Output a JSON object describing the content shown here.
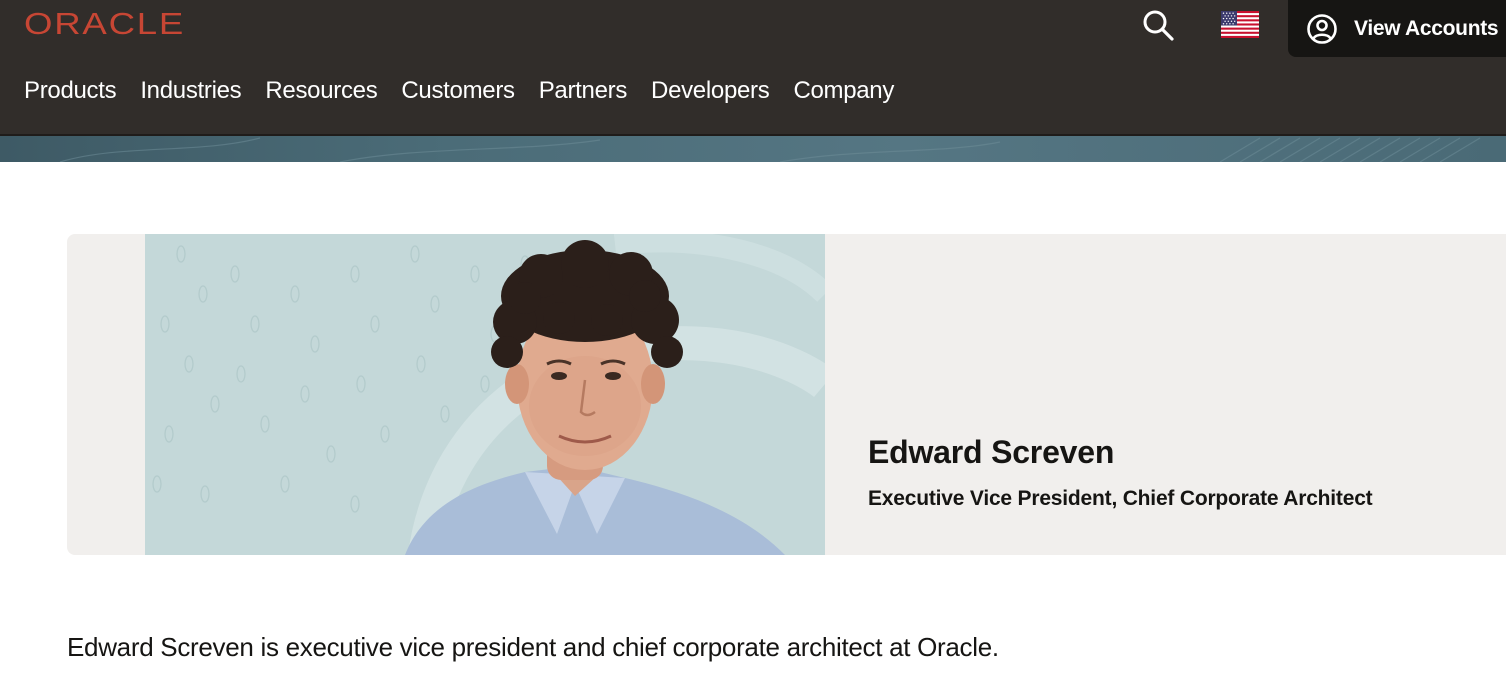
{
  "header": {
    "logo_text": "ORACLE",
    "nav": [
      {
        "label": "Products"
      },
      {
        "label": "Industries"
      },
      {
        "label": "Resources"
      },
      {
        "label": "Customers"
      },
      {
        "label": "Partners"
      },
      {
        "label": "Developers"
      },
      {
        "label": "Company"
      }
    ],
    "search_icon": "search-icon",
    "country_icon": "us-flag-icon",
    "account_icon": "user-circle-icon",
    "account_label": "View Accounts"
  },
  "profile": {
    "name": "Edward Screven",
    "title": "Executive Vice President, Chief Corporate Architect",
    "photo": "portrait-photo"
  },
  "bio": {
    "text": "Edward Screven is executive vice president and chief corporate architect at Oracle."
  },
  "colors": {
    "header_bg": "#312d2a",
    "brand_red": "#c74634",
    "account_bg": "#161513",
    "card_bg": "#f1efed",
    "photo_bg": "#c4d8d9"
  }
}
